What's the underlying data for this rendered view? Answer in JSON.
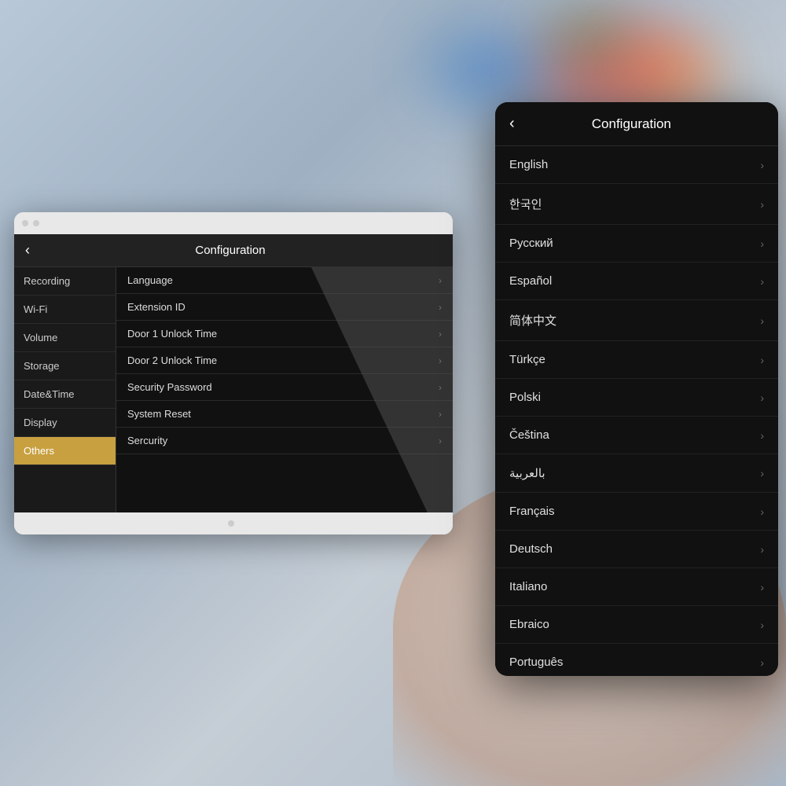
{
  "background": {
    "color": "#b0c2d0"
  },
  "device": {
    "header_title": "Configuration",
    "back_label": "‹",
    "sidebar": {
      "items": [
        {
          "label": "Recording",
          "active": false
        },
        {
          "label": "Wi-Fi",
          "active": false
        },
        {
          "label": "Volume",
          "active": false
        },
        {
          "label": "Storage",
          "active": false
        },
        {
          "label": "Date&Time",
          "active": false
        },
        {
          "label": "Display",
          "active": false
        },
        {
          "label": "Others",
          "active": true
        }
      ]
    },
    "menu": {
      "items": [
        {
          "label": "Language",
          "has_chevron": true
        },
        {
          "label": "Extension ID",
          "has_chevron": true
        },
        {
          "label": "Door 1 Unlock Time",
          "has_chevron": true
        },
        {
          "label": "Door 2 Unlock Time",
          "has_chevron": true
        },
        {
          "label": "Security Password",
          "has_chevron": true
        },
        {
          "label": "System Reset",
          "has_chevron": true
        },
        {
          "label": "Sercurity",
          "has_chevron": true
        }
      ]
    }
  },
  "phone": {
    "header_title": "Configuration",
    "back_label": "‹",
    "language_list": [
      {
        "label": "English"
      },
      {
        "label": "한국인"
      },
      {
        "label": "Русский"
      },
      {
        "label": "Español"
      },
      {
        "label": "简体中文"
      },
      {
        "label": "Türkçe"
      },
      {
        "label": "Polski"
      },
      {
        "label": "Čeština"
      },
      {
        "label": "بالعربية"
      },
      {
        "label": "Français"
      },
      {
        "label": "Deutsch"
      },
      {
        "label": "Italiano"
      },
      {
        "label": "Ebraico"
      },
      {
        "label": "Português"
      }
    ],
    "chevron": "›"
  }
}
